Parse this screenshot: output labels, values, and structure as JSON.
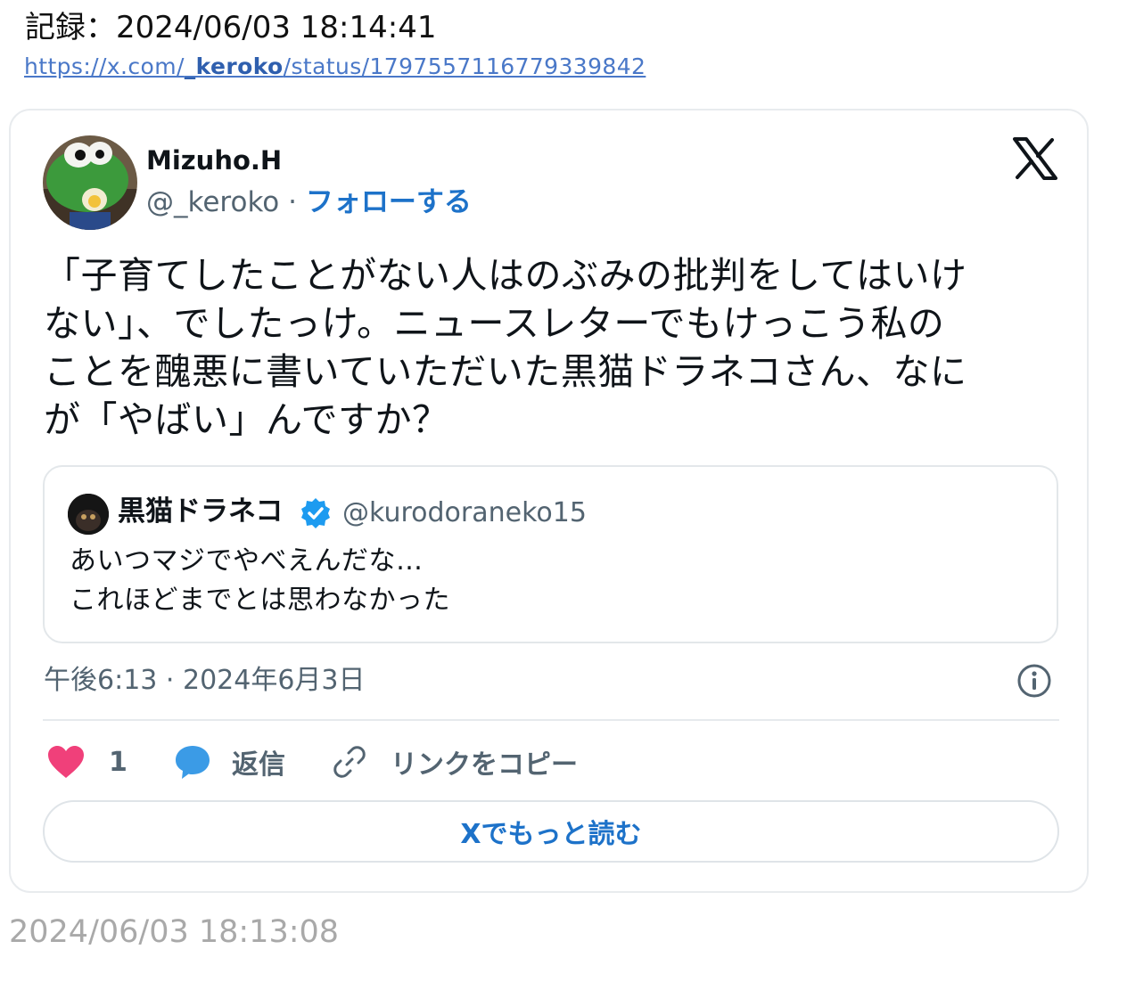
{
  "record": {
    "label": "記録：2024/06/03 18:14:41",
    "link_prefix": "https://x.com/",
    "link_user": "_keroko",
    "link_suffix": "/status/1797557116779339842"
  },
  "tweet": {
    "author_name": "Mizuho.H",
    "author_handle": "@_keroko",
    "separator": " · ",
    "follow_label": "フォローする",
    "text": "「子育てしたことがない人はのぶみの批判をしてはいけ\nない」、でしたっけ。ニュースレターでもけっこう私の\nことを醜悪に書いていただいた黒猫ドラネコさん、なに\nが「やばい」んですか？",
    "quote": {
      "author_name": "黒猫ドラネコ",
      "author_handle": "@kurodoraneko15",
      "text": "あいつマジでやべえんだな…\nこれほどまでとは思わなかった"
    },
    "timestamp": "午後6:13 · 2024年6月3日",
    "actions": {
      "like_count": "1",
      "reply_label": "返信",
      "copy_label": "リンクをコピー"
    },
    "read_more_label": "Xでもっと読む"
  },
  "footer": {
    "time": "2024/06/03 18:13:08"
  },
  "colors": {
    "link": "#4a78c8",
    "follow": "#1d72c9",
    "like": "#f0407a",
    "reply": "#3b9be6",
    "verified": "#1d9bf0",
    "muted": "#536471"
  },
  "icons": [
    "x-logo-icon",
    "verified-badge-icon",
    "info-icon",
    "heart-icon",
    "reply-bubble-icon",
    "link-icon"
  ]
}
